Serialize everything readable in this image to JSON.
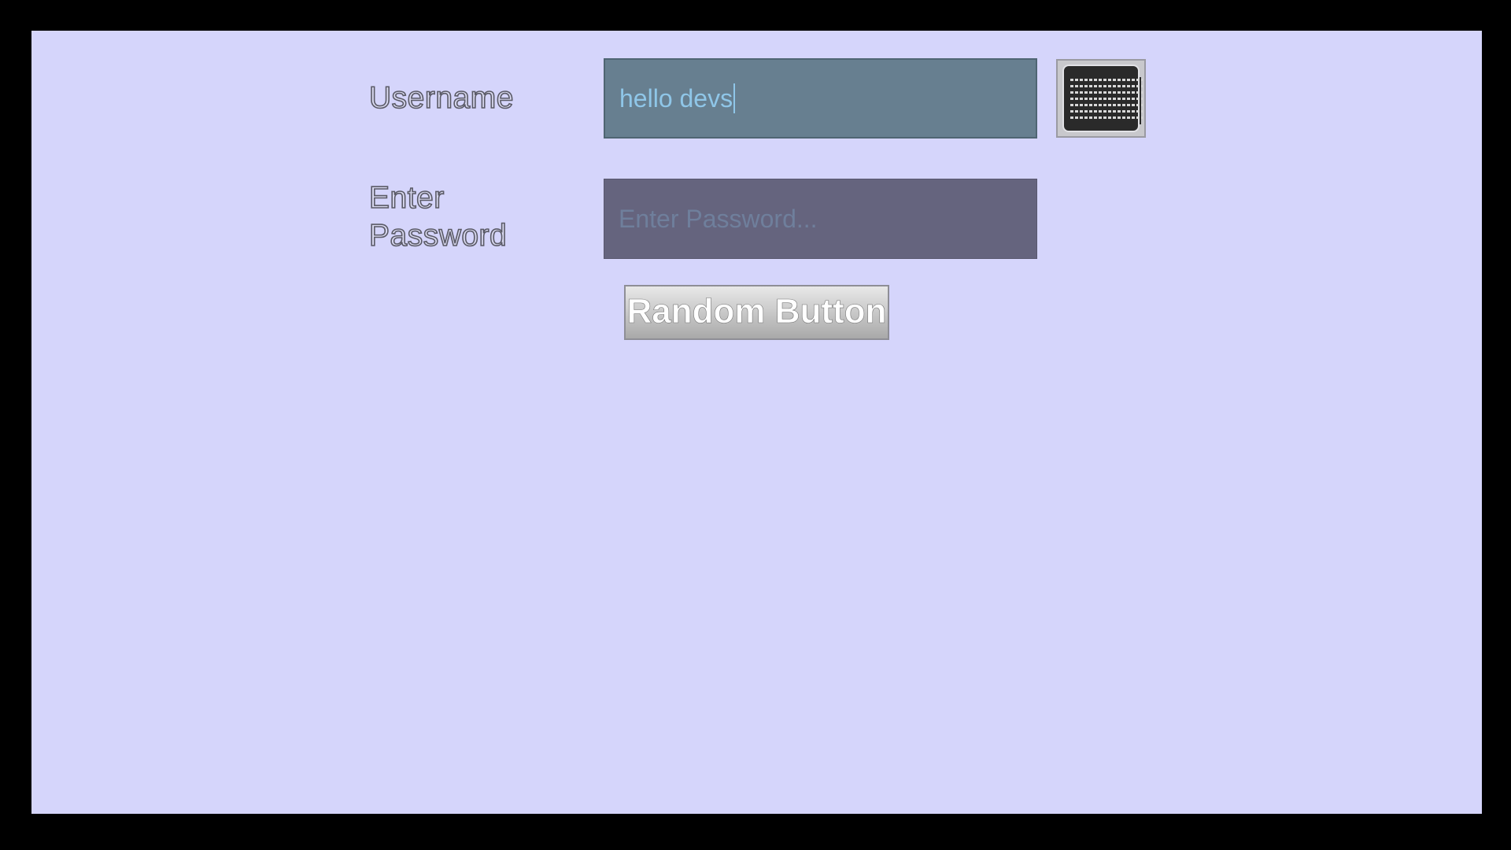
{
  "form": {
    "username_label": "Username",
    "username_value": "hello devs",
    "password_label": "Enter Password",
    "password_placeholder": "Enter Password..."
  },
  "keyboard_button": {
    "icon": "keyboard-icon"
  },
  "random_button": {
    "label": "Random Button"
  },
  "colors": {
    "background": "#d5d5fb",
    "username_field": "#677f90",
    "password_field": "#65647e",
    "username_text": "#8fc6e8"
  }
}
